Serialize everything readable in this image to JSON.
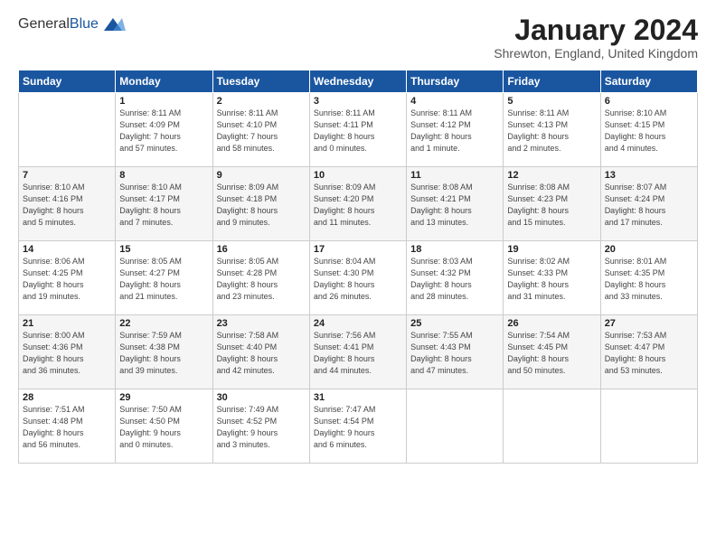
{
  "header": {
    "logo_general": "General",
    "logo_blue": "Blue",
    "title": "January 2024",
    "subtitle": "Shrewton, England, United Kingdom"
  },
  "weekdays": [
    "Sunday",
    "Monday",
    "Tuesday",
    "Wednesday",
    "Thursday",
    "Friday",
    "Saturday"
  ],
  "weeks": [
    [
      {
        "num": "",
        "info": ""
      },
      {
        "num": "1",
        "info": "Sunrise: 8:11 AM\nSunset: 4:09 PM\nDaylight: 7 hours\nand 57 minutes."
      },
      {
        "num": "2",
        "info": "Sunrise: 8:11 AM\nSunset: 4:10 PM\nDaylight: 7 hours\nand 58 minutes."
      },
      {
        "num": "3",
        "info": "Sunrise: 8:11 AM\nSunset: 4:11 PM\nDaylight: 8 hours\nand 0 minutes."
      },
      {
        "num": "4",
        "info": "Sunrise: 8:11 AM\nSunset: 4:12 PM\nDaylight: 8 hours\nand 1 minute."
      },
      {
        "num": "5",
        "info": "Sunrise: 8:11 AM\nSunset: 4:13 PM\nDaylight: 8 hours\nand 2 minutes."
      },
      {
        "num": "6",
        "info": "Sunrise: 8:10 AM\nSunset: 4:15 PM\nDaylight: 8 hours\nand 4 minutes."
      }
    ],
    [
      {
        "num": "7",
        "info": "Sunrise: 8:10 AM\nSunset: 4:16 PM\nDaylight: 8 hours\nand 5 minutes."
      },
      {
        "num": "8",
        "info": "Sunrise: 8:10 AM\nSunset: 4:17 PM\nDaylight: 8 hours\nand 7 minutes."
      },
      {
        "num": "9",
        "info": "Sunrise: 8:09 AM\nSunset: 4:18 PM\nDaylight: 8 hours\nand 9 minutes."
      },
      {
        "num": "10",
        "info": "Sunrise: 8:09 AM\nSunset: 4:20 PM\nDaylight: 8 hours\nand 11 minutes."
      },
      {
        "num": "11",
        "info": "Sunrise: 8:08 AM\nSunset: 4:21 PM\nDaylight: 8 hours\nand 13 minutes."
      },
      {
        "num": "12",
        "info": "Sunrise: 8:08 AM\nSunset: 4:23 PM\nDaylight: 8 hours\nand 15 minutes."
      },
      {
        "num": "13",
        "info": "Sunrise: 8:07 AM\nSunset: 4:24 PM\nDaylight: 8 hours\nand 17 minutes."
      }
    ],
    [
      {
        "num": "14",
        "info": "Sunrise: 8:06 AM\nSunset: 4:25 PM\nDaylight: 8 hours\nand 19 minutes."
      },
      {
        "num": "15",
        "info": "Sunrise: 8:05 AM\nSunset: 4:27 PM\nDaylight: 8 hours\nand 21 minutes."
      },
      {
        "num": "16",
        "info": "Sunrise: 8:05 AM\nSunset: 4:28 PM\nDaylight: 8 hours\nand 23 minutes."
      },
      {
        "num": "17",
        "info": "Sunrise: 8:04 AM\nSunset: 4:30 PM\nDaylight: 8 hours\nand 26 minutes."
      },
      {
        "num": "18",
        "info": "Sunrise: 8:03 AM\nSunset: 4:32 PM\nDaylight: 8 hours\nand 28 minutes."
      },
      {
        "num": "19",
        "info": "Sunrise: 8:02 AM\nSunset: 4:33 PM\nDaylight: 8 hours\nand 31 minutes."
      },
      {
        "num": "20",
        "info": "Sunrise: 8:01 AM\nSunset: 4:35 PM\nDaylight: 8 hours\nand 33 minutes."
      }
    ],
    [
      {
        "num": "21",
        "info": "Sunrise: 8:00 AM\nSunset: 4:36 PM\nDaylight: 8 hours\nand 36 minutes."
      },
      {
        "num": "22",
        "info": "Sunrise: 7:59 AM\nSunset: 4:38 PM\nDaylight: 8 hours\nand 39 minutes."
      },
      {
        "num": "23",
        "info": "Sunrise: 7:58 AM\nSunset: 4:40 PM\nDaylight: 8 hours\nand 42 minutes."
      },
      {
        "num": "24",
        "info": "Sunrise: 7:56 AM\nSunset: 4:41 PM\nDaylight: 8 hours\nand 44 minutes."
      },
      {
        "num": "25",
        "info": "Sunrise: 7:55 AM\nSunset: 4:43 PM\nDaylight: 8 hours\nand 47 minutes."
      },
      {
        "num": "26",
        "info": "Sunrise: 7:54 AM\nSunset: 4:45 PM\nDaylight: 8 hours\nand 50 minutes."
      },
      {
        "num": "27",
        "info": "Sunrise: 7:53 AM\nSunset: 4:47 PM\nDaylight: 8 hours\nand 53 minutes."
      }
    ],
    [
      {
        "num": "28",
        "info": "Sunrise: 7:51 AM\nSunset: 4:48 PM\nDaylight: 8 hours\nand 56 minutes."
      },
      {
        "num": "29",
        "info": "Sunrise: 7:50 AM\nSunset: 4:50 PM\nDaylight: 9 hours\nand 0 minutes."
      },
      {
        "num": "30",
        "info": "Sunrise: 7:49 AM\nSunset: 4:52 PM\nDaylight: 9 hours\nand 3 minutes."
      },
      {
        "num": "31",
        "info": "Sunrise: 7:47 AM\nSunset: 4:54 PM\nDaylight: 9 hours\nand 6 minutes."
      },
      {
        "num": "",
        "info": ""
      },
      {
        "num": "",
        "info": ""
      },
      {
        "num": "",
        "info": ""
      }
    ]
  ]
}
